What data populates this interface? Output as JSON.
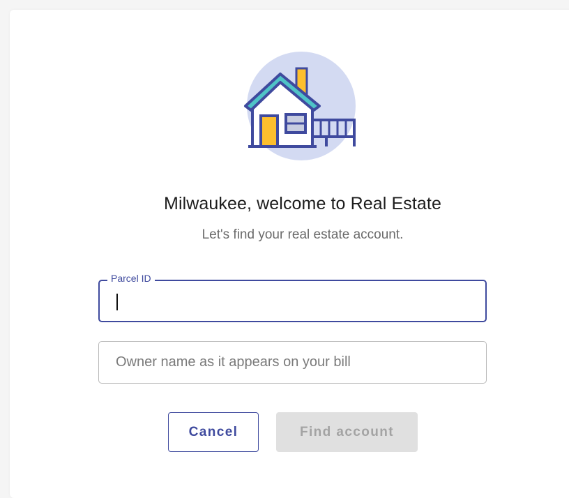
{
  "header": {
    "title": "Milwaukee, welcome to Real Estate",
    "subtitle": "Let's find your real estate account."
  },
  "illustration": {
    "icon": "house-icon",
    "colors": {
      "circle": "#d3daf2",
      "roof": "#4fc3c7",
      "outline": "#3f4a9e",
      "door": "#fdbf2d",
      "chimney": "#fdbf2d"
    }
  },
  "form": {
    "parcel": {
      "label": "Parcel ID",
      "value": "",
      "placeholder": ""
    },
    "owner": {
      "value": "",
      "placeholder": "Owner name as it appears on your bill"
    }
  },
  "actions": {
    "cancel_label": "Cancel",
    "find_label": "Find account"
  },
  "colors": {
    "accent": "#3f4a9e",
    "disabled_bg": "#e0e0e0",
    "disabled_text": "#a3a3a3"
  }
}
